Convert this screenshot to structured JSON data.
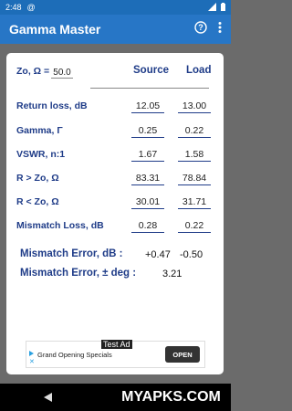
{
  "status": {
    "time": "2:48",
    "signal_icon": "signal-icon",
    "battery_icon": "battery-icon"
  },
  "appbar": {
    "title": "Gamma Master",
    "help_icon": "help-icon",
    "menu_icon": "more-vert-icon"
  },
  "form": {
    "zo_label": "Zo, Ω =",
    "zo_value": "50.0",
    "col_source": "Source",
    "col_load": "Load",
    "rows": [
      {
        "label": "Return loss, dB",
        "source": "12.05",
        "load": "13.00"
      },
      {
        "label": "Gamma, Γ",
        "source": "0.25",
        "load": "0.22"
      },
      {
        "label": "VSWR, n:1",
        "source": "1.67",
        "load": "1.58"
      },
      {
        "label": "R > Zo, Ω",
        "source": "83.31",
        "load": "78.84"
      },
      {
        "label": "R < Zo, Ω",
        "source": "30.01",
        "load": "31.71"
      },
      {
        "label": "Mismatch Loss, dB",
        "source": "0.28",
        "load": "0.22"
      }
    ],
    "mismatch_db_label": "Mismatch Error, dB :",
    "mismatch_db_plus": "+0.47",
    "mismatch_db_minus": "-0.50",
    "mismatch_deg_label": "Mismatch Error, ± deg :",
    "mismatch_deg_value": "3.21"
  },
  "ad": {
    "tag": "Test Ad",
    "text": "Grand Opening Specials",
    "button": "OPEN"
  },
  "watermark": "MYAPKS.COM"
}
